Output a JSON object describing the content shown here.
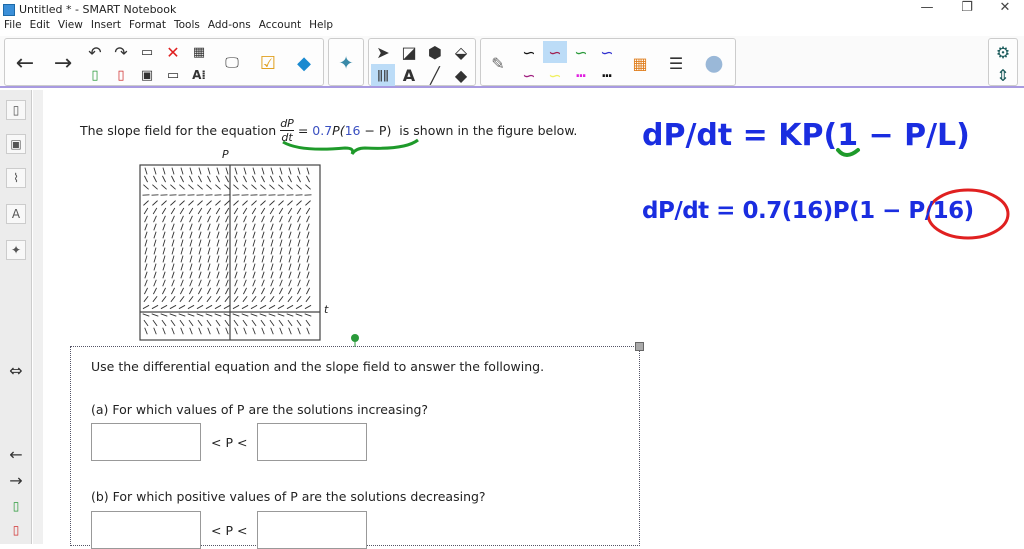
{
  "window": {
    "title": "Untitled * - SMART Notebook",
    "minimize": "—",
    "restore": "❐",
    "close": "✕"
  },
  "menu": [
    "File",
    "Edit",
    "View",
    "Insert",
    "Format",
    "Tools",
    "Add-ons",
    "Account",
    "Help"
  ],
  "problem": {
    "prefix": "The slope field for the equation",
    "frac_num": "dP",
    "frac_den": "dt",
    "eq_rhs_black": "= ",
    "coef": "0.7",
    "p1": "P(",
    "sixteen": "16",
    "rest": " − P)",
    "suffix": "is shown in the figure below.",
    "axis_p": "P",
    "axis_t": "t"
  },
  "questions": {
    "intro": "Use the differential equation and the slope field to answer the following.",
    "a": "(a) For which values of P are the solutions increasing?",
    "b": "(b) For which positive values of P are the solutions decreasing?",
    "ineq": "< P <",
    "a_lower": "",
    "a_upper": "",
    "b_lower": "",
    "b_upper": ""
  },
  "handwriting": {
    "line1": "dP/dt = KP(1 − P/L)",
    "line2": "dP/dt = 0.7(16)P(1 − P/16)",
    "ink_color": "#1a2de0",
    "circle_color": "#e02020",
    "underline_color": "#1e9a2a"
  },
  "colors": {
    "accent": "#a89ae0"
  }
}
